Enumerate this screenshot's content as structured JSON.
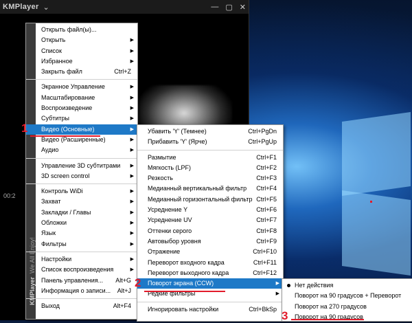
{
  "kmplayer": {
    "title": "KMPlayer",
    "title_arrow": "⌄",
    "controls": [
      "—",
      "▢",
      "✕"
    ],
    "side_time": "00:2",
    "stripe_brand": "KMPlayer",
    "stripe_slogan": "We All Enjoy!"
  },
  "main_menu": {
    "items": [
      {
        "label": "Открыть файл(ы)...",
        "shortcut": "",
        "submenu": false
      },
      {
        "label": "Открыть",
        "shortcut": "",
        "submenu": true
      },
      {
        "label": "Список",
        "shortcut": "",
        "submenu": true
      },
      {
        "label": "Избранное",
        "shortcut": "",
        "submenu": true
      },
      {
        "label": "Закрыть файл",
        "shortcut": "Ctrl+Z",
        "submenu": false
      },
      {
        "sep": true
      },
      {
        "label": "Экранное Управление",
        "shortcut": "",
        "submenu": true
      },
      {
        "label": "Масштабирование",
        "shortcut": "",
        "submenu": true
      },
      {
        "label": "Воспроизведение",
        "shortcut": "",
        "submenu": true
      },
      {
        "label": "Субтитры",
        "shortcut": "",
        "submenu": true
      },
      {
        "label": "Видео (Основные)",
        "shortcut": "",
        "submenu": true,
        "highlight": true
      },
      {
        "label": "Видео (Расширенные)",
        "shortcut": "",
        "submenu": true
      },
      {
        "label": "Аудио",
        "shortcut": "",
        "submenu": true
      },
      {
        "sep": true
      },
      {
        "label": "Управление 3D субтитрами",
        "shortcut": "",
        "submenu": true
      },
      {
        "label": "3D screen control",
        "shortcut": "",
        "submenu": true
      },
      {
        "sep": true
      },
      {
        "label": "Контроль WiDi",
        "shortcut": "",
        "submenu": true
      },
      {
        "label": "Захват",
        "shortcut": "",
        "submenu": true
      },
      {
        "label": "Закладки / Главы",
        "shortcut": "",
        "submenu": true
      },
      {
        "label": "Обложки",
        "shortcut": "",
        "submenu": true
      },
      {
        "label": "Язык",
        "shortcut": "",
        "submenu": true
      },
      {
        "label": "Фильтры",
        "shortcut": "",
        "submenu": true
      },
      {
        "sep": true
      },
      {
        "label": "Настройки",
        "shortcut": "",
        "submenu": true
      },
      {
        "label": "Список воспроизведения",
        "shortcut": "",
        "submenu": true
      },
      {
        "label": "Панель управления...",
        "shortcut": "Alt+G",
        "submenu": false
      },
      {
        "label": "Информация о записи...",
        "shortcut": "Alt+J",
        "submenu": false
      },
      {
        "sep": true
      },
      {
        "label": "Выход",
        "shortcut": "Alt+F4",
        "submenu": false
      }
    ]
  },
  "video_menu": {
    "items": [
      {
        "label": "Убавить 'Y' (Темнее)",
        "shortcut": "Ctrl+PgDn",
        "submenu": false
      },
      {
        "label": "Прибавить 'Y' (Ярче)",
        "shortcut": "Ctrl+PgUp",
        "submenu": false
      },
      {
        "sep": true
      },
      {
        "label": "Размытие",
        "shortcut": "Ctrl+F1",
        "submenu": false
      },
      {
        "label": "Мягкость (LPF)",
        "shortcut": "Ctrl+F2",
        "submenu": false
      },
      {
        "label": "Резкость",
        "shortcut": "Ctrl+F3",
        "submenu": false
      },
      {
        "label": "Медианный вертикальный фильтр",
        "shortcut": "Ctrl+F4",
        "submenu": false
      },
      {
        "label": "Медианный горизонтальный фильтр",
        "shortcut": "Ctrl+F5",
        "submenu": false
      },
      {
        "label": "Усреднение Y",
        "shortcut": "Ctrl+F6",
        "submenu": false
      },
      {
        "label": "Усреднение UV",
        "shortcut": "Ctrl+F7",
        "submenu": false
      },
      {
        "label": "Оттенки серого",
        "shortcut": "Ctrl+F8",
        "submenu": false
      },
      {
        "label": "Автовыбор уровня",
        "shortcut": "Ctrl+F9",
        "submenu": false
      },
      {
        "label": "Отражение",
        "shortcut": "Ctrl+F10",
        "submenu": false
      },
      {
        "label": "Переворот входного кадра",
        "shortcut": "Ctrl+F11",
        "submenu": false
      },
      {
        "label": "Переворот выходного кадра",
        "shortcut": "Ctrl+F12",
        "submenu": false
      },
      {
        "label": "Поворот экрана (CCW)",
        "shortcut": "",
        "submenu": true,
        "highlight": true
      },
      {
        "label": "Редкие фильтры",
        "shortcut": "",
        "submenu": true
      },
      {
        "sep": true
      },
      {
        "label": "Игнорировать настройки",
        "shortcut": "Ctrl+BkSp",
        "submenu": false
      }
    ]
  },
  "rotate_menu": {
    "items": [
      {
        "label": "Нет действия",
        "checked": true
      },
      {
        "label": "Поворот на 90 градусов + Переворот",
        "checked": false
      },
      {
        "label": "Поворот на 270 градусов",
        "checked": false
      },
      {
        "label": "Поворот на 90 градусов",
        "checked": false
      }
    ]
  },
  "annotations": [
    "1",
    "2",
    "3"
  ],
  "colors": {
    "highlight": "#1e79c7",
    "annotation": "#e21b2b"
  }
}
